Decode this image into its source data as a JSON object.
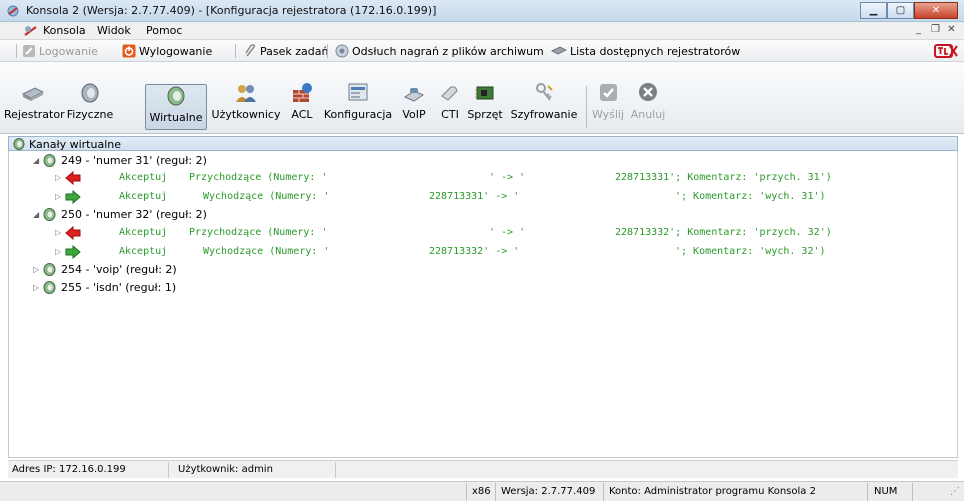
{
  "window": {
    "title": "Konsola 2 (Wersja:  2.7.77.409) - [Konfiguracja rejestratora (172.16.0.199)]"
  },
  "menu": {
    "items": [
      "Konsola",
      "Widok",
      "Pomoc"
    ]
  },
  "toolbar1": {
    "login": "Logowanie",
    "logout": "Wylogowanie",
    "taskbar": "Pasek zadań",
    "archive_listen": "Odsłuch nagrań z plików archiwum",
    "recorders_list": "Lista dostępnych rejestratorów"
  },
  "toolbar2": {
    "buttons": [
      "Rejestrator",
      "Fizyczne",
      "Wirtualne",
      "Użytkownicy",
      "ACL",
      "Konfiguracja",
      "VoIP",
      "CTI",
      "Sprzęt",
      "Szyfrowanie",
      "Wyślij",
      "Anuluj"
    ],
    "active": "Wirtualne"
  },
  "tree": {
    "header": "Kanały wirtualne",
    "nodes": [
      {
        "label": "249 - 'numer 31' (reguł: 2)",
        "expanded": true
      },
      {
        "label": "250 - 'numer 32' (reguł: 2)",
        "expanded": true
      },
      {
        "label": "254 - 'voip' (reguł: 2)",
        "expanded": false
      },
      {
        "label": "255 - 'isdn' (reguł: 1)",
        "expanded": false
      }
    ],
    "rules": [
      {
        "action": "Akceptuj",
        "direction": "Przychodzące (Numery: '",
        "num_a": "' -> '",
        "num_b": "228713331'; Komentarz: 'przych. 31')"
      },
      {
        "action": "Akceptuj",
        "direction": "Wychodzące (Numery: '",
        "num_a": "228713331' -> '",
        "num_b": "'; Komentarz: 'wych. 31')"
      },
      {
        "action": "Akceptuj",
        "direction": "Przychodzące (Numery: '",
        "num_a": "' -> '",
        "num_b": "228713332'; Komentarz: 'przych. 32')"
      },
      {
        "action": "Akceptuj",
        "direction": "Wychodzące (Numery: '",
        "num_a": "228713332' -> '",
        "num_b": "'; Komentarz: 'wych. 32')"
      }
    ]
  },
  "status_inner": {
    "ip": "Adres IP: 172.16.0.199",
    "user": "Użytkownik: admin"
  },
  "status_outer": {
    "arch": "x86",
    "version": "Wersja: 2.7.77.409",
    "account": "Konto: Administrator programu Konsola 2",
    "num": "NUM"
  },
  "colors": {
    "rule_text": "#2a9a2a",
    "incoming_arrow": "#e02020",
    "outgoing_arrow": "#3aa83a",
    "title_bar": "#c7d9ec"
  }
}
